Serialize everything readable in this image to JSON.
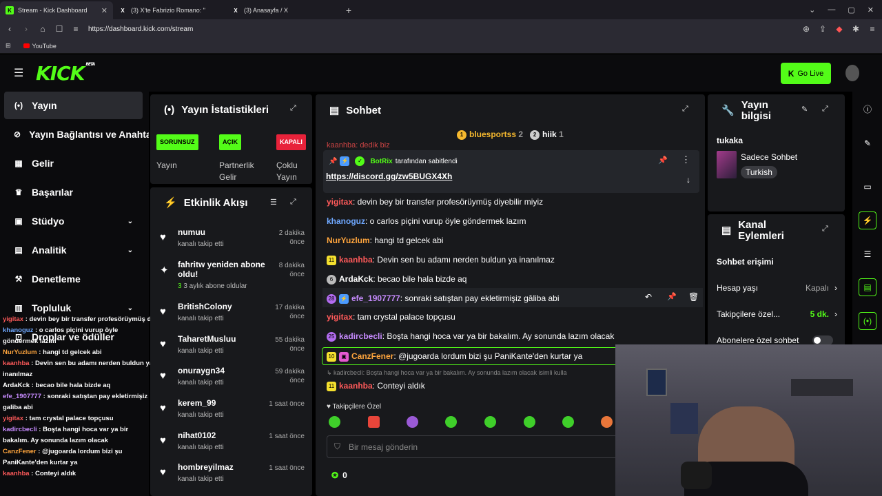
{
  "browser": {
    "tabs": [
      {
        "title": "Stream - Kick Dashboard",
        "active": true
      },
      {
        "title": "(3) X'te Fabrizio Romano: \"",
        "active": false
      },
      {
        "title": "(3) Anasayfa / X",
        "active": false
      }
    ],
    "url": "https://dashboard.kick.com/stream",
    "bookmarks": [
      "YouTube"
    ]
  },
  "header": {
    "logo": "KICK",
    "beta": "BETA",
    "go_live": "Go Live"
  },
  "sidebar": {
    "items": [
      {
        "label": "Yayın"
      },
      {
        "label": "Yayın Bağlantısı ve Anahtarı"
      },
      {
        "label": "Gelir"
      },
      {
        "label": "Başarılar"
      },
      {
        "label": "Stüdyo"
      },
      {
        "label": "Analitik"
      },
      {
        "label": "Denetleme"
      },
      {
        "label": "Topluluk"
      },
      {
        "label": "Droplar ve ödüller"
      }
    ]
  },
  "overlay_chat": [
    {
      "user": "yigitax",
      "text": " : devin bey bir transfer profesörüymüş diyebilir miyiz",
      "color": "#ff5a5a"
    },
    {
      "user": "khanoguz",
      "text": " : o carlos piçini vurup öyle göndermek lazım",
      "color": "#6fa8ff"
    },
    {
      "user": "NurYuzlum",
      "text": " : hangi td gelcek abi",
      "color": "#ffa53d"
    },
    {
      "user": "kaanhba",
      "text": " : Devin sen bu adamı nerden buldun ya inanılmaz",
      "color": "#ff5a5a"
    },
    {
      "user": "ArdaKck",
      "text": " : becao bile hala bizde aq",
      "color": "#ffffff"
    },
    {
      "user": "efe_1907777",
      "text": " : sonraki satıştan pay ekletirmişiz galiba abi",
      "color": "#c78bff"
    },
    {
      "user": "yigitax",
      "text": " : tam crystal palace topçusu",
      "color": "#ff5a5a"
    },
    {
      "user": "kadircbecli",
      "text": " : Boşta hangi hoca var ya bir bakalım. Ay sonunda lazım olacak",
      "color": "#c78bff"
    },
    {
      "user": "CanzFener",
      "text": " : @jugoarda lordum bizi şu PaniKante'den kurtar ya",
      "color": "#ffa53d"
    },
    {
      "user": "kaanhba",
      "text": " : Conteyi aldık",
      "color": "#ff5a5a"
    }
  ],
  "stats": {
    "title": "Yayın İstatistikleri",
    "cols": [
      {
        "badge": "SORUNSUZ",
        "label": "Yayın",
        "color": "#53fc18"
      },
      {
        "badge": "AÇIK",
        "label": "Partnerlik Gelir",
        "color": "#53fc18"
      },
      {
        "badge": "KAPALI",
        "label": "Çoklu Yayın",
        "color": "#e8223a"
      }
    ]
  },
  "activity": {
    "title": "Etkinlik Akışı",
    "items": [
      {
        "name": "numuu",
        "sub": "kanalı takip etti",
        "time": "2 dakika önce",
        "icon": "heart-icon"
      },
      {
        "name": "fahritw yeniden abone oldu!",
        "sub": "3 aylık abone oldular",
        "sub_highlight": "3",
        "time": "8 dakika önce",
        "icon": "sparkle-icon"
      },
      {
        "name": "BritishColony",
        "sub": "kanalı takip etti",
        "time": "17 dakika önce",
        "icon": "heart-icon"
      },
      {
        "name": "TaharetMusluu",
        "sub": "kanalı takip etti",
        "time": "55 dakika önce",
        "icon": "heart-icon"
      },
      {
        "name": "onuraygn34",
        "sub": "kanalı takip etti",
        "time": "59 dakika önce",
        "icon": "heart-icon"
      },
      {
        "name": "kerem_99",
        "sub": "kanalı takip etti",
        "time": "1 saat önce",
        "icon": "heart-icon"
      },
      {
        "name": "nihat0102",
        "sub": "kanalı takip etti",
        "time": "1 saat önce",
        "icon": "heart-icon"
      },
      {
        "name": "hombreyilmaz",
        "sub": "kanalı takip etti",
        "time": "1 saat önce",
        "icon": "heart-icon"
      }
    ]
  },
  "chat": {
    "title": "Sohbet",
    "top": [
      {
        "name": "bluesportss",
        "count": "2",
        "rank": "1"
      },
      {
        "name": "hiik",
        "count": "1",
        "rank": "2"
      }
    ],
    "partial_line": "kaanhba: dedik biz",
    "pinned": {
      "by": "BotRix",
      "by_suffix": "tarafından sabitlendi",
      "link": "https://discord.gg/zw5BUGX4Xh"
    },
    "messages": [
      {
        "user": "yigitax",
        "color": "#ff5a5a",
        "text": ": devin bey bir transfer profesörüymüş diyebilir miyiz",
        "badge": ""
      },
      {
        "user": "khanoguz",
        "color": "#6fa8ff",
        "text": ": o carlos piçini vurup öyle göndermek lazım",
        "badge": ""
      },
      {
        "user": "NurYuzlum",
        "color": "#ffa53d",
        "text": ": hangi td gelcek abi",
        "badge": ""
      },
      {
        "user": "kaanhba",
        "color": "#ff5a5a",
        "text": ": Devin sen bu adamı nerden buldun ya inanılmaz",
        "badge": "11"
      },
      {
        "user": "ArdaKck",
        "color": "#ffffff",
        "text": ": becao bile hala bizde aq",
        "badge": "6"
      },
      {
        "user": "efe_1907777",
        "color": "#c78bff",
        "text": ": sonraki satıştan pay ekletirmişiz gâliba abi",
        "badge": "28"
      },
      {
        "user": "yigitax",
        "color": "#ff5a5a",
        "text": ": tam crystal palace topçusu",
        "badge": ""
      },
      {
        "user": "kadircbecli",
        "color": "#c78bff",
        "text": ": Boşta hangi hoca var ya bir bakalım. Ay sonunda lazım olacak",
        "badge": "25"
      },
      {
        "user": "CanzFener",
        "color": "#ffa53d",
        "text": ": @jugoarda lordum bizi şu PaniKante'den kurtar ya",
        "badge": "10"
      },
      {
        "user": "kaanhba",
        "color": "#ff5a5a",
        "text": ": Conteyi aldık",
        "badge": "11"
      }
    ],
    "reply_preview": "kadircbecli: Boşta hangi hoca var ya bir bakalım. Ay sonunda lazım olacak isimli kulla",
    "followers_only": "Takipçilere Özel",
    "input_placeholder": "Bir mesaj gönderin",
    "points": "0"
  },
  "stream_info": {
    "title": "Yayın bilgisi",
    "stream_title": "tukaka",
    "category": "Sadece Sohbet",
    "language": "Turkish"
  },
  "channel_actions": {
    "title": "Kanal Eylemleri",
    "section": "Sohbet erişimi",
    "rows": [
      {
        "label": "Hesap yaşı",
        "value": "Kapalı"
      },
      {
        "label": "Takipçilere özel...",
        "value": "5 dk."
      },
      {
        "label": "Abonelere özel sohbet",
        "value": ""
      }
    ]
  },
  "colors": {
    "accent": "#53fc18",
    "panel": "#18191c",
    "bg": "#0b0b0d"
  }
}
